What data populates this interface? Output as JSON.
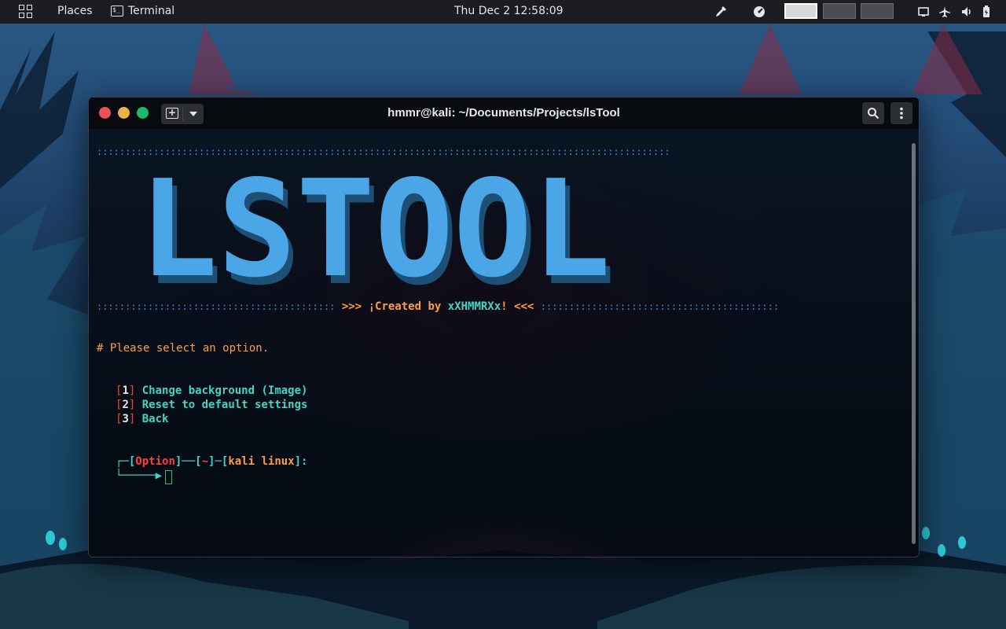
{
  "topbar": {
    "activities_icon": "grid-icon",
    "places_label": "Places",
    "app_label": "Terminal",
    "app_icon": "terminal-icon",
    "clock": "Thu Dec 2  12:58:09",
    "tray_icons": [
      "color-picker-icon",
      "speedometer-icon",
      "screen-icon",
      "airplane-icon",
      "volume-icon",
      "battery-icon"
    ],
    "workspaces": 3,
    "active_workspace": 1
  },
  "window": {
    "title": "hmmr@kali: ~/Documents/Projects/lsTool",
    "traffic_lights": [
      "#ed4f5f",
      "#e9b348",
      "#1fb86a"
    ]
  },
  "terminal": {
    "separator_top": "::::::::::::::::::::::::::::::::::::::::::::::::::::::::::::::::::::::::::::::::::::::::::::::::::::::::::::::::::::::::::::::::",
    "banner_text": "LSTOOL",
    "credit_left_dots": "::::::::::::::::::::::::::::::::::::::::::",
    "credit_open": ">>> ¡Created by ",
    "credit_author": "xXHMMRXx",
    "credit_close": "! <<<",
    "credit_right_dots": "::::::::::::::::::::::::::::::::::::::::::",
    "prompt_text": "# Please select an option.",
    "menu": [
      {
        "num": "1",
        "label": "Change background (Image)"
      },
      {
        "num": "2",
        "label": "Reset to default settings"
      },
      {
        "num": "3",
        "label": "Back"
      }
    ],
    "ps1": {
      "open": "┌─[",
      "option": "Option",
      "mid1": "]──[",
      "tilde": "~",
      "mid2": "]─[",
      "host": "kali linux",
      "end": "]:",
      "arrow": "└─────▶"
    }
  },
  "colors": {
    "accent_blue": "#4aa6e6",
    "orange": "#ff9c43",
    "teal": "#3fd6c6",
    "red": "#ff3d3d",
    "cursor": "#22c55e"
  }
}
